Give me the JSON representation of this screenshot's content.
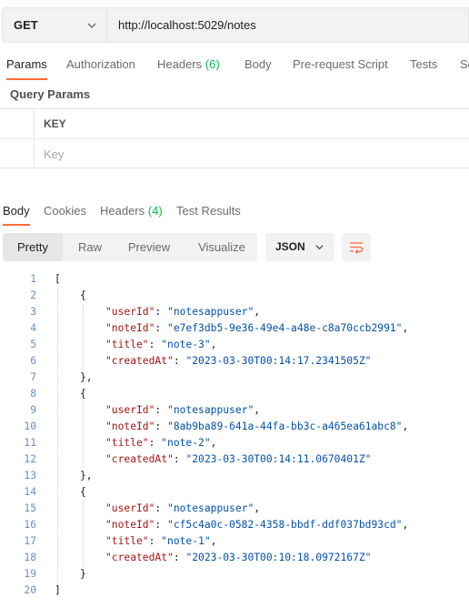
{
  "request": {
    "method": "GET",
    "url": "http://localhost:5029/notes"
  },
  "request_tabs": [
    {
      "label": "Params",
      "count": ""
    },
    {
      "label": "Authorization",
      "count": ""
    },
    {
      "label": "Headers",
      "count": "(6)"
    },
    {
      "label": "Body",
      "count": ""
    },
    {
      "label": "Pre-request Script",
      "count": ""
    },
    {
      "label": "Tests",
      "count": ""
    },
    {
      "label": "Se",
      "count": ""
    }
  ],
  "query_params": {
    "title": "Query Params",
    "key_header": "KEY",
    "key_placeholder": "Key"
  },
  "response_tabs": [
    {
      "label": "Body",
      "count": ""
    },
    {
      "label": "Cookies",
      "count": ""
    },
    {
      "label": "Headers",
      "count": "(4)"
    },
    {
      "label": "Test Results",
      "count": ""
    }
  ],
  "view_modes": [
    "Pretty",
    "Raw",
    "Preview",
    "Visualize"
  ],
  "format": "JSON",
  "icons": {
    "method_dropdown": "chevron-down-icon",
    "format_dropdown": "chevron-down-icon",
    "wrap": "wrap-lines-icon"
  },
  "colors": {
    "accent": "#ff6c37",
    "count": "#0cbb52",
    "json_key": "#a31515",
    "json_string": "#0451a5",
    "line_number": "#6b8dc1"
  },
  "response_lines": [
    {
      "n": "1",
      "indent": 0,
      "text": "["
    },
    {
      "n": "2",
      "indent": 1,
      "text": "{"
    },
    {
      "n": "3",
      "indent": 2,
      "key": "\"userId\"",
      "value": "\"notesappuser\"",
      "trail": ","
    },
    {
      "n": "4",
      "indent": 2,
      "key": "\"noteId\"",
      "value": "\"e7ef3db5-9e36-49e4-a48e-c8a70ccb2991\"",
      "trail": ","
    },
    {
      "n": "5",
      "indent": 2,
      "key": "\"title\"",
      "value": "\"note-3\"",
      "trail": ","
    },
    {
      "n": "6",
      "indent": 2,
      "key": "\"createdAt\"",
      "value": "\"2023-03-30T00:14:17.2341505Z\"",
      "trail": ""
    },
    {
      "n": "7",
      "indent": 1,
      "text": "},"
    },
    {
      "n": "8",
      "indent": 1,
      "text": "{"
    },
    {
      "n": "9",
      "indent": 2,
      "key": "\"userId\"",
      "value": "\"notesappuser\"",
      "trail": ","
    },
    {
      "n": "10",
      "indent": 2,
      "key": "\"noteId\"",
      "value": "\"8ab9ba89-641a-44fa-bb3c-a465ea61abc8\"",
      "trail": ","
    },
    {
      "n": "11",
      "indent": 2,
      "key": "\"title\"",
      "value": "\"note-2\"",
      "trail": ","
    },
    {
      "n": "12",
      "indent": 2,
      "key": "\"createdAt\"",
      "value": "\"2023-03-30T00:14:11.0670401Z\"",
      "trail": ""
    },
    {
      "n": "13",
      "indent": 1,
      "text": "},"
    },
    {
      "n": "14",
      "indent": 1,
      "text": "{"
    },
    {
      "n": "15",
      "indent": 2,
      "key": "\"userId\"",
      "value": "\"notesappuser\"",
      "trail": ","
    },
    {
      "n": "16",
      "indent": 2,
      "key": "\"noteId\"",
      "value": "\"cf5c4a0c-0582-4358-bbdf-ddf037bd93cd\"",
      "trail": ","
    },
    {
      "n": "17",
      "indent": 2,
      "key": "\"title\"",
      "value": "\"note-1\"",
      "trail": ","
    },
    {
      "n": "18",
      "indent": 2,
      "key": "\"createdAt\"",
      "value": "\"2023-03-30T00:10:18.0972167Z\"",
      "trail": ""
    },
    {
      "n": "19",
      "indent": 1,
      "text": "}"
    },
    {
      "n": "20",
      "indent": 0,
      "text": "]"
    }
  ]
}
